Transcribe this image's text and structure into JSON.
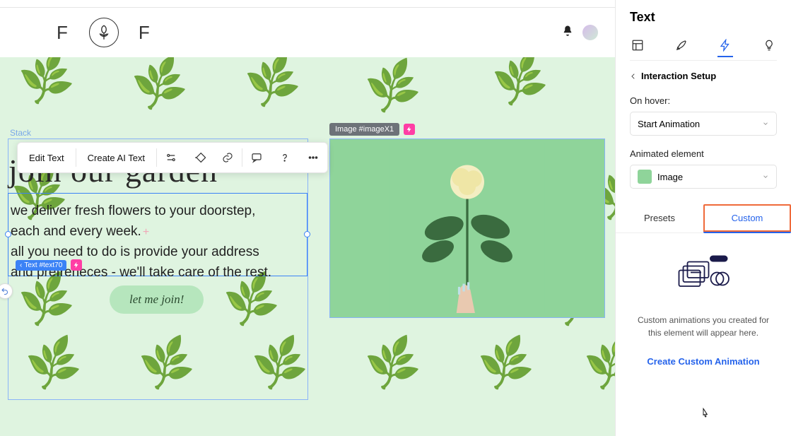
{
  "brand": {
    "left": "F",
    "right": "F"
  },
  "canvas": {
    "stack_label": "Stack",
    "text_chip": "Text #text70",
    "hero_heading": "join our garden",
    "body_line1": "we deliver fresh flowers to your doorstep,",
    "body_line2": "each and every week.",
    "body_line3": "all you need to do is provide your address",
    "body_line4": "and prefreneces - we'll take care of the rest.",
    "cta": "let me join!",
    "image_tag": "Image #imageX1"
  },
  "toolbar": {
    "edit_text": "Edit Text",
    "create_ai": "Create AI Text"
  },
  "panel": {
    "title": "Text",
    "back": "Interaction Setup",
    "onhover_label": "On hover:",
    "onhover_value": "Start Animation",
    "animated_label": "Animated element",
    "animated_value": "Image",
    "tab_presets": "Presets",
    "tab_custom": "Custom",
    "empty_msg": "Custom animations you created for this element will appear here.",
    "create_link": "Create Custom Animation"
  }
}
